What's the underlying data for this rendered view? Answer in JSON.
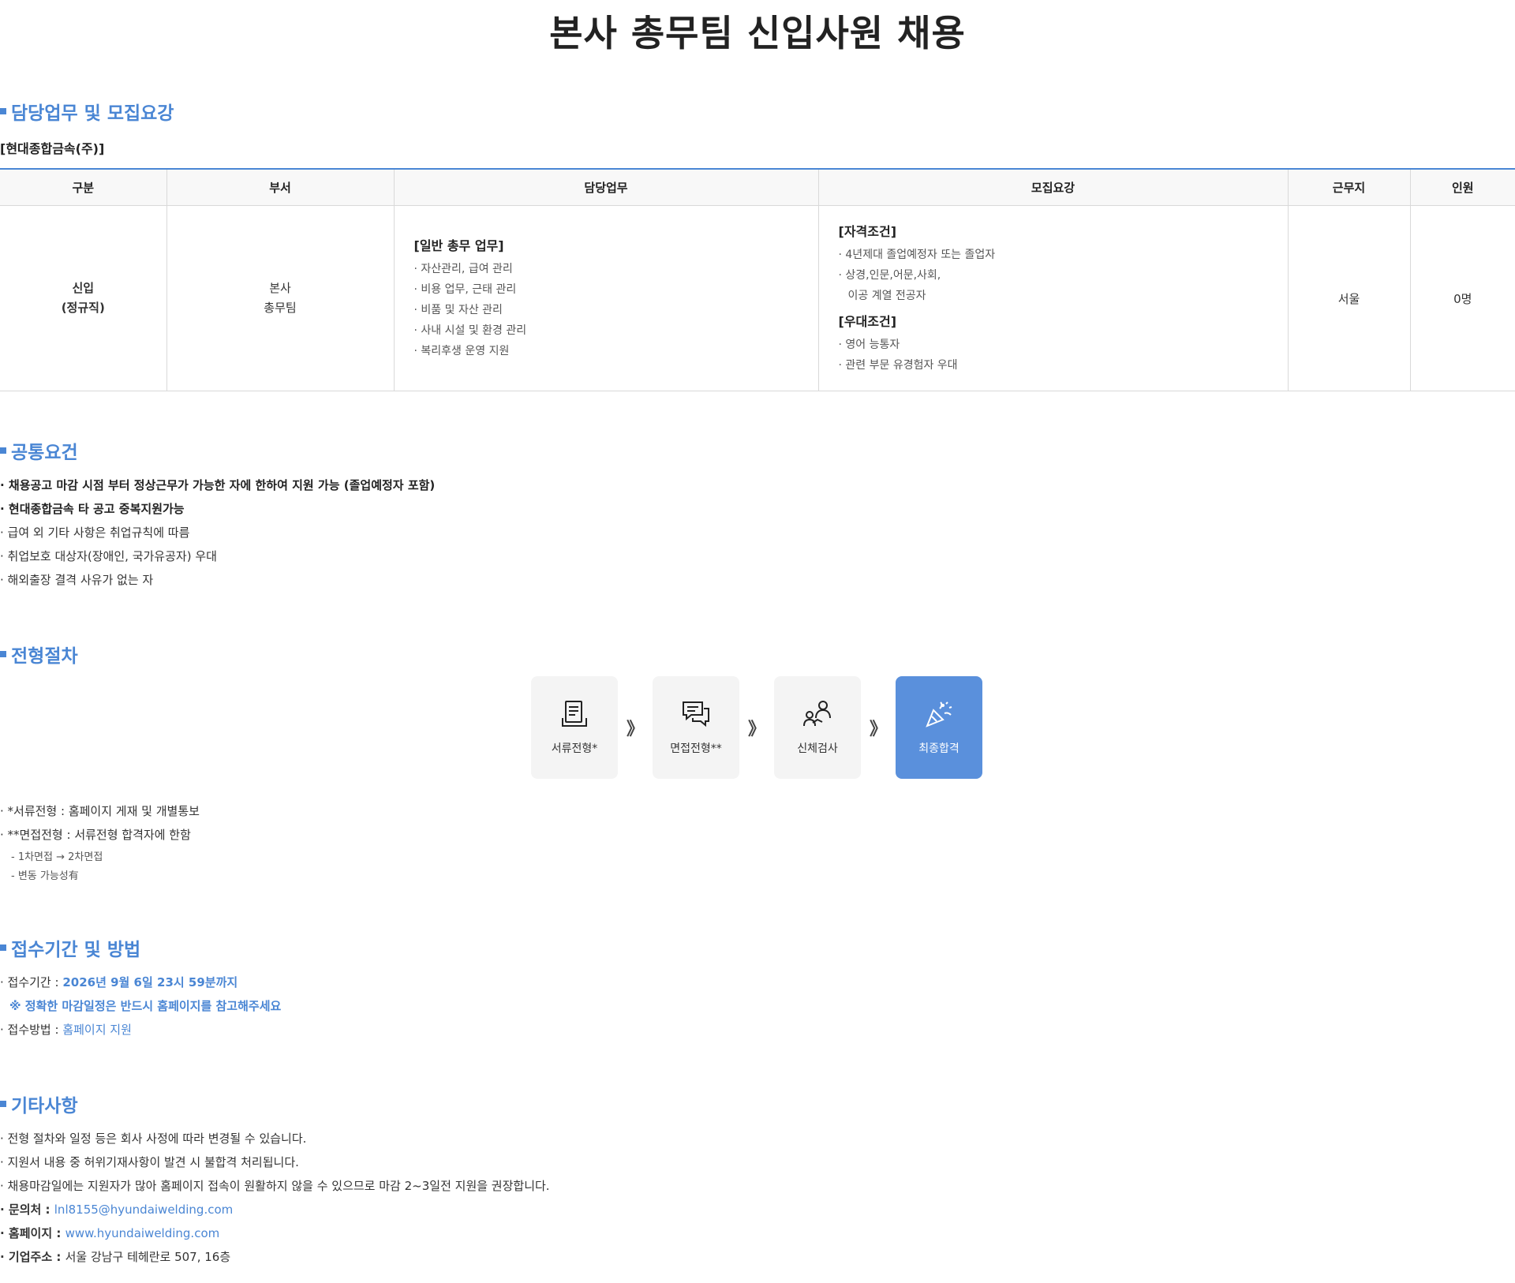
{
  "title": "본사 총무팀 신입사원 채용",
  "section1": {
    "heading": "담당업무 및 모집요강",
    "company": "[현대종합금속(주)]",
    "table": {
      "headers": [
        "구분",
        "부서",
        "담당업무",
        "모집요강",
        "근무지",
        "인원"
      ],
      "row": {
        "category": [
          "신입",
          "(정규직)"
        ],
        "dept": [
          "본사",
          "총무팀"
        ],
        "duty_title": "[일반 총무 업무]",
        "duties": [
          "· 자산관리, 급여 관리",
          "· 비용 업무, 근태 관리",
          "· 비품 및 자산 관리",
          "· 사내 시설 및 환경 관리",
          "· 복리후생 운영 지원"
        ],
        "qual_title": "[자격조건]",
        "quals": [
          "· 4년제대 졸업예정자 또는 졸업자",
          "· 상경,인문,어문,사회,",
          "이공 계열 전공자"
        ],
        "pref_title": "[우대조건]",
        "prefs": [
          "· 영어 능통자",
          "· 관련 부문 유경험자 우대"
        ],
        "location": "서울",
        "headcount": "0명"
      }
    }
  },
  "section2": {
    "heading": "공통요건",
    "items": [
      "· 채용공고 마감 시점 부터 정상근무가 가능한 자에 한하여 지원 가능 (졸업예정자 포함)",
      "· 현대종합금속 타 공고 중복지원가능",
      "· 급여 외 기타 사항은 취업규칙에 따름",
      "· 취업보호 대상자(장애인, 국가유공자) 우대",
      "· 해외출장 결격 사유가 없는 자"
    ]
  },
  "section3": {
    "heading": "전형절차",
    "steps": [
      {
        "label": "서류전형*",
        "icon": "document-icon"
      },
      {
        "label": "면접전형**",
        "icon": "chat-bubbles-icon"
      },
      {
        "label": "신체검사",
        "icon": "people-icon"
      },
      {
        "label": "최종합격",
        "icon": "party-popper-icon"
      }
    ],
    "arrow": "》",
    "notes": [
      "· *서류전형 : 홈페이지 게재 및 개별통보",
      "· **면접전형 : 서류전형 합격자에 한함"
    ],
    "subnotes": [
      "- 1차면접 → 2차면접",
      "- 변동 가능성有"
    ]
  },
  "section4": {
    "heading": "접수기간 및 방법",
    "period_label": "· 접수기간 : ",
    "period_value": "2026년 9월 6일 23시 59분까지",
    "notice": "※ 정확한 마감일정은 반드시 홈페이지를 참고해주세요",
    "method_label": "· 접수방법 : ",
    "method_value": "홈페이지 지원"
  },
  "section5": {
    "heading": "기타사항",
    "items": [
      "· 전형 절차와 일정 등은 회사 사정에 따라 변경될 수 있습니다.",
      "· 지원서 내용 중 허위기재사항이 발견 시 불합격 처리됩니다.",
      "· 채용마감일에는 지원자가 많아 홈페이지 접속이 원활하지 않을 수 있으므로 마감 2~3일전 지원을 권장합니다."
    ],
    "contact_label": "· 문의처 : ",
    "contact_value": "lnl8155@hyundaiwelding.com",
    "homepage_label": "· 홈페이지 : ",
    "homepage_value": "www.hyundaiwelding.com",
    "address_label": "· 기업주소 : ",
    "address_value": "서울 강남구 테헤란로 507, 16층"
  },
  "colors": {
    "accent": "#4a86d4",
    "final_step": "#5a90dc",
    "step_bg": "#f4f4f4"
  }
}
